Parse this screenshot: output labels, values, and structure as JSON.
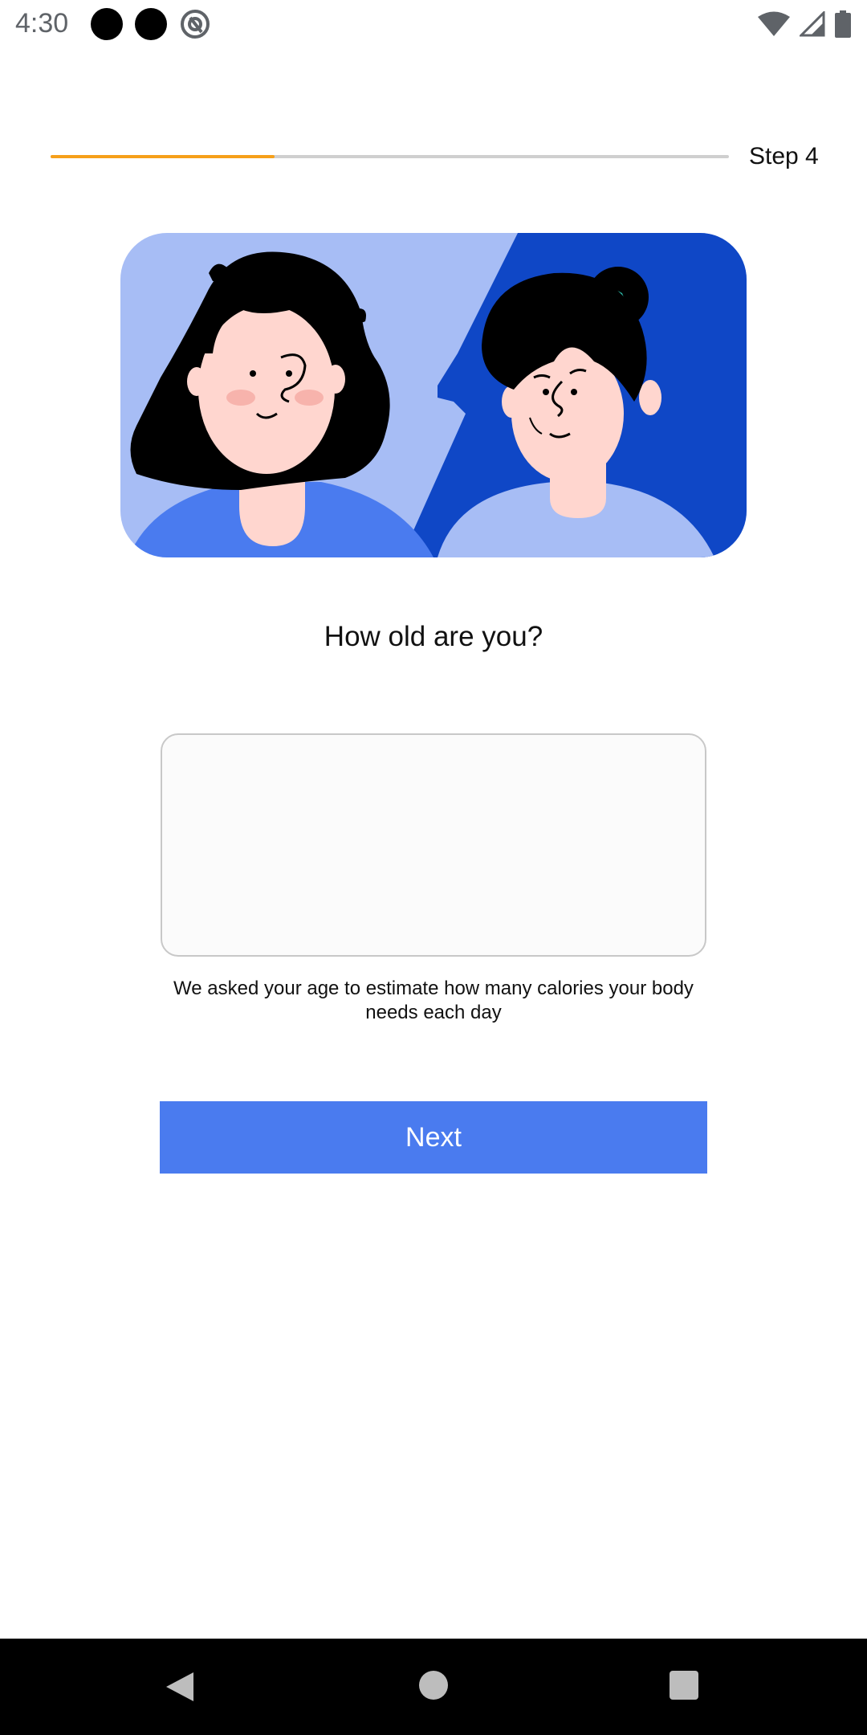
{
  "status_bar": {
    "time": "4:30",
    "left_icons": [
      "notification-dot-icon",
      "notification-dot-icon",
      "at-sign-icon"
    ],
    "right_icons": [
      "wifi-icon",
      "cell-signal-icon",
      "battery-icon"
    ]
  },
  "progress": {
    "step_label": "Step 4",
    "fraction": 0.33,
    "fill_color": "#f6a01a",
    "track_color": "#cfcfcf"
  },
  "illustration": {
    "icon": "young-and-older-woman-illustration",
    "bg_light": "#a7bdf5",
    "bg_dark": "#0f47c6"
  },
  "question": "How old are you?",
  "age_input": {
    "value": "",
    "placeholder": ""
  },
  "helper_text": "We asked your age to estimate how many calories your body needs each day",
  "next_button": {
    "label": "Next",
    "color": "#4a7bef"
  },
  "nav_bar": {
    "icons": [
      "back-triangle-icon",
      "home-circle-icon",
      "recents-square-icon"
    ]
  }
}
